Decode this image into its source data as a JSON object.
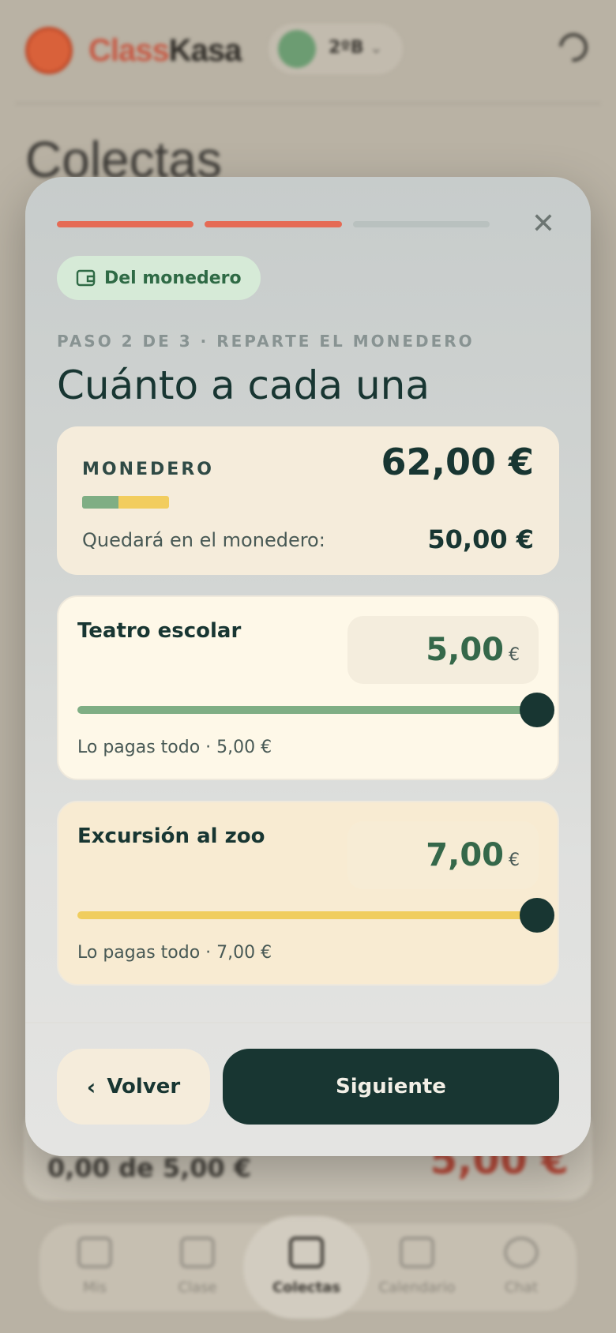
{
  "background": {
    "app_name_part1": "Class",
    "app_name_part2": "Kasa",
    "class_selector": "2ºB",
    "page_title": "Colectas",
    "card_progress": "0,00 de 5,00 €",
    "card_amount": "5,00 €",
    "nav": [
      {
        "label": "Mis",
        "icon": "home-icon"
      },
      {
        "label": "Clase",
        "icon": "class-icon"
      },
      {
        "label": "Colectas",
        "icon": "wallet-icon"
      },
      {
        "label": "Calendario",
        "icon": "calendar-icon"
      },
      {
        "label": "Chat",
        "icon": "chat-icon"
      }
    ],
    "active_nav": "Colectas"
  },
  "modal": {
    "progress_steps": [
      {
        "state": "done",
        "color": "#e56b55"
      },
      {
        "state": "done",
        "color": "#e56b55"
      },
      {
        "state": "pending",
        "color": "#b9c1bf"
      }
    ],
    "close_icon": "close-icon",
    "mode_label": "Del monedero",
    "mode_icon": "wallet-icon",
    "step_label": "PASO 2 DE 3 · REPARTE EL MONEDERO",
    "title": "Cuánto a cada una",
    "wallet": {
      "label": "MONEDERO",
      "total": "62,00 €",
      "remaining_label": "Quedará en el monedero:",
      "remaining_value": "50,00 €"
    },
    "items": [
      {
        "name": "Teatro escolar",
        "amount": "5,00",
        "currency": "€",
        "slider_fraction": 1.0,
        "note": "Lo pagas todo · 5,00 €",
        "color": "#7fae84"
      },
      {
        "name": "Excursión al zoo",
        "amount": "7,00",
        "currency": "€",
        "slider_fraction": 1.0,
        "note": "Lo pagas todo · 7,00 €",
        "color": "#f0cd5e"
      }
    ],
    "back_label": "Volver",
    "next_label": "Siguiente"
  }
}
